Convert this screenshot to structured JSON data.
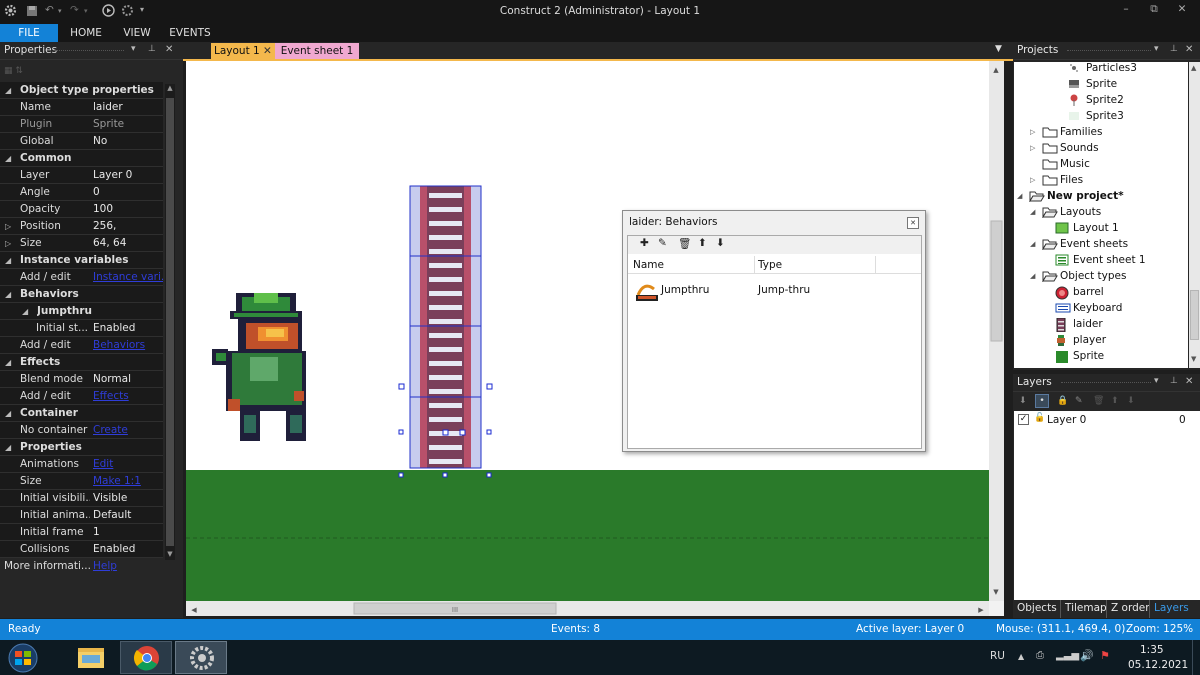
{
  "window": {
    "title": "Construct 2 (Administrator) - Layout 1",
    "controls": {
      "minimize": "–",
      "restore": "⧉",
      "close": "✕"
    }
  },
  "ribbon": {
    "tabs": [
      {
        "label": "FILE"
      },
      {
        "label": "HOME"
      },
      {
        "label": "VIEW"
      },
      {
        "label": "EVENTS"
      }
    ]
  },
  "properties_panel": {
    "title": "Properties",
    "rows": [
      {
        "type": "cat",
        "label": "Object type properties",
        "expanded": true
      },
      {
        "type": "prop",
        "key": "Name",
        "value": "laider"
      },
      {
        "type": "prop",
        "key": "Plugin",
        "value": "Sprite",
        "dim": true
      },
      {
        "type": "prop",
        "key": "Global",
        "value": "No"
      },
      {
        "type": "cat",
        "label": "Common",
        "expanded": true
      },
      {
        "type": "prop",
        "key": "Layer",
        "value": "Layer 0"
      },
      {
        "type": "prop",
        "key": "Angle",
        "value": "0"
      },
      {
        "type": "prop",
        "key": "Opacity",
        "value": "100"
      },
      {
        "type": "prop",
        "key": "Position",
        "value": "256,",
        "expander": true
      },
      {
        "type": "prop",
        "key": "Size",
        "value": "64, 64",
        "expander": true
      },
      {
        "type": "cat",
        "label": "Instance variables",
        "expanded": true
      },
      {
        "type": "prop",
        "key": "Add / edit",
        "value": "Instance vari...",
        "link": true
      },
      {
        "type": "cat",
        "label": "Behaviors",
        "expanded": true
      },
      {
        "type": "subcat",
        "label": "Jumpthru",
        "expanded": true
      },
      {
        "type": "prop",
        "key": "Initial st...",
        "value": "Enabled",
        "indent": true
      },
      {
        "type": "prop",
        "key": "Add / edit",
        "value": "Behaviors",
        "link": true
      },
      {
        "type": "cat",
        "label": "Effects",
        "expanded": true
      },
      {
        "type": "prop",
        "key": "Blend mode",
        "value": "Normal"
      },
      {
        "type": "prop",
        "key": "Add / edit",
        "value": "Effects",
        "link": true
      },
      {
        "type": "cat",
        "label": "Container",
        "expanded": true
      },
      {
        "type": "prop",
        "key": "No container",
        "value": "Create",
        "link": true
      },
      {
        "type": "cat",
        "label": "Properties",
        "expanded": true
      },
      {
        "type": "prop",
        "key": "Animations",
        "value": "Edit",
        "link": true
      },
      {
        "type": "prop",
        "key": "Size",
        "value": "Make 1:1",
        "link": true
      },
      {
        "type": "prop",
        "key": "Initial visibili...",
        "value": "Visible"
      },
      {
        "type": "prop",
        "key": "Initial anima...",
        "value": "Default"
      },
      {
        "type": "prop",
        "key": "Initial frame",
        "value": "1"
      },
      {
        "type": "prop",
        "key": "Collisions",
        "value": "Enabled"
      },
      {
        "type": "footer",
        "key": "More informati...",
        "value": "Help",
        "link": true
      }
    ]
  },
  "document_tabs": [
    {
      "label": "Layout 1",
      "active": true,
      "closable": true
    },
    {
      "label": "Event sheet 1",
      "active": false,
      "closable": false
    }
  ],
  "behaviors_dialog": {
    "title": "laider: Behaviors",
    "toolbar": [
      "add-icon",
      "edit-icon",
      "delete-icon",
      "move-up-icon",
      "move-down-icon"
    ],
    "columns": [
      "Name",
      "Type"
    ],
    "rows": [
      {
        "name": "Jumpthru",
        "type": "Jump-thru"
      }
    ]
  },
  "horizontal_scroll": {
    "grip": "III"
  },
  "projects_panel": {
    "title": "Projects",
    "items": [
      {
        "label": "Particles3",
        "icon": "particles-icon",
        "indent": 4
      },
      {
        "label": "Sprite",
        "icon": "sprite-gray-icon",
        "indent": 4
      },
      {
        "label": "Sprite2",
        "icon": "sprite-pin-icon",
        "indent": 4
      },
      {
        "label": "Sprite3",
        "icon": "sprite-light-icon",
        "indent": 4
      },
      {
        "label": "Families",
        "icon": "folder-icon",
        "indent": 2,
        "expander": "▷"
      },
      {
        "label": "Sounds",
        "icon": "folder-icon",
        "indent": 2,
        "expander": "▷"
      },
      {
        "label": "Music",
        "icon": "folder-icon",
        "indent": 2,
        "expander": ""
      },
      {
        "label": "Files",
        "icon": "folder-icon",
        "indent": 2,
        "expander": "▷"
      },
      {
        "label": "New project*",
        "icon": "folder-open-icon",
        "indent": 1,
        "expander": "◢",
        "bold": true
      },
      {
        "label": "Layouts",
        "icon": "folder-open-icon",
        "indent": 2,
        "expander": "◢"
      },
      {
        "label": "Layout 1",
        "icon": "layout-icon",
        "indent": 3
      },
      {
        "label": "Event sheets",
        "icon": "folder-open-icon",
        "indent": 2,
        "expander": "◢"
      },
      {
        "label": "Event sheet 1",
        "icon": "eventsheet-icon",
        "indent": 3
      },
      {
        "label": "Object types",
        "icon": "folder-open-icon",
        "indent": 2,
        "expander": "◢"
      },
      {
        "label": "barrel",
        "icon": "barrel-icon",
        "indent": 3
      },
      {
        "label": "Keyboard",
        "icon": "keyboard-icon",
        "indent": 3
      },
      {
        "label": "laider",
        "icon": "ladder-icon",
        "indent": 3
      },
      {
        "label": "player",
        "icon": "player-icon",
        "indent": 3
      },
      {
        "label": "Sprite",
        "icon": "sprite-green-icon",
        "indent": 3
      }
    ]
  },
  "layers_panel": {
    "title": "Layers",
    "layers": [
      {
        "name": "Layer 0",
        "index": "0",
        "visible": true,
        "locked": false
      }
    ],
    "bottom_tabs": [
      {
        "label": "Objects",
        "active": false
      },
      {
        "label": "Tilemap",
        "active": false
      },
      {
        "label": "Z order",
        "active": false
      },
      {
        "label": "Layers",
        "active": true
      }
    ]
  },
  "statusbar": {
    "ready": "Ready",
    "events": "Events: 8",
    "active_layer": "Active layer: Layer 0",
    "mouse": "Mouse: (311.1, 469.4, 0)",
    "zoom": "Zoom: 125%"
  },
  "taskbar": {
    "lang": "RU",
    "time": "1:35",
    "date": "05.12.2021"
  },
  "colors": {
    "accent": "#1382d7",
    "ground": "#2a7a2a",
    "canvas": "#f2f2f2",
    "active_tab": "#f4b84c",
    "eventsheet_tab": "#f0a8d0"
  }
}
